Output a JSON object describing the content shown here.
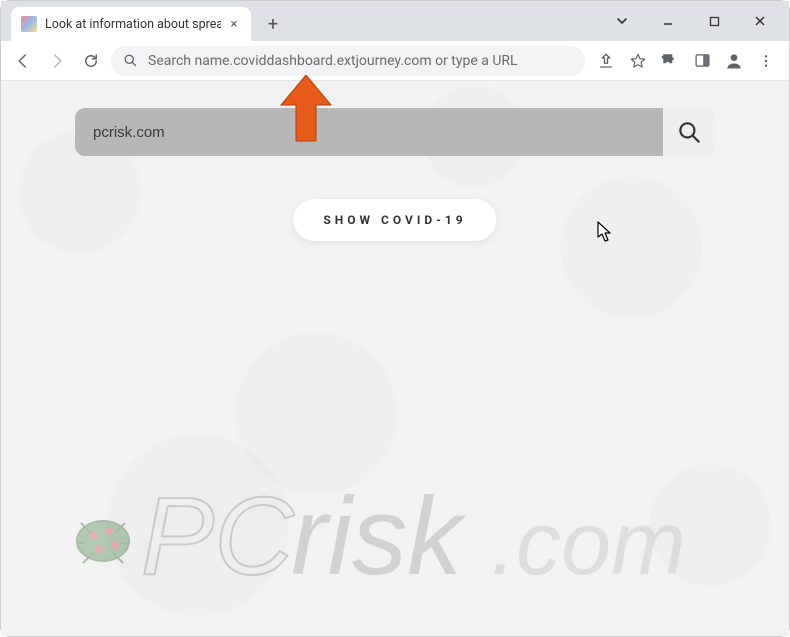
{
  "window": {
    "tab_title": "Look at information about spread",
    "new_tab_label": "+",
    "close_label": "×"
  },
  "omnibox": {
    "placeholder": "Search name.coviddashboard.extjourney.com or type a URL"
  },
  "content": {
    "search_value": "pcrisk.com",
    "show_button_label": "SHOW COVID-19"
  },
  "watermark": {
    "brand_part1": "PC",
    "brand_part2": "risk",
    "brand_tld": ".com"
  },
  "arrow": {
    "color": "#e85a1a"
  }
}
